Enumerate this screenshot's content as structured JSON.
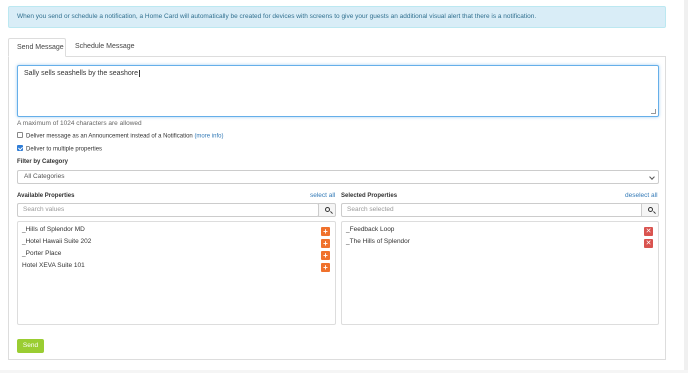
{
  "alert": {
    "text": "When you send or schedule a notification, a Home Card will automatically be created for devices with screens to give your guests an additional visual alert that there is a notification."
  },
  "tabs": [
    {
      "label": "Send Message",
      "active": true
    },
    {
      "label": "Schedule Message",
      "active": false
    }
  ],
  "message": {
    "value": "Sally sells seashells by the seashore"
  },
  "hint": "A maximum of 1024 characters are allowed",
  "options": {
    "announcement": {
      "label": "Deliver message as an Announcement instead of a Notification",
      "more": "(more info)",
      "checked": false
    },
    "multiple": {
      "label": "Deliver to multiple properties",
      "checked": true
    }
  },
  "filter": {
    "label": "Filter by Category",
    "selected": "All Categories"
  },
  "available": {
    "title": "Available Properties",
    "select_all": "select all",
    "search_placeholder": "Search values",
    "items": [
      "_Hills of Splendor MD",
      "_Hotel Hawaii Suite 202",
      "_Porter Place",
      "Hotel XEVA Suite 101"
    ]
  },
  "selected": {
    "title": "Selected Properties",
    "deselect_all": "deselect all",
    "search_placeholder": "Search selected",
    "items": [
      "_Feedback Loop",
      "_The Hills of Splendor"
    ]
  },
  "send_label": "Send",
  "colors": {
    "accent": "#f0712c",
    "remove": "#d9534f",
    "send": "#9acd32",
    "alert_bg": "#d9edf7",
    "link": "#337ab7"
  }
}
